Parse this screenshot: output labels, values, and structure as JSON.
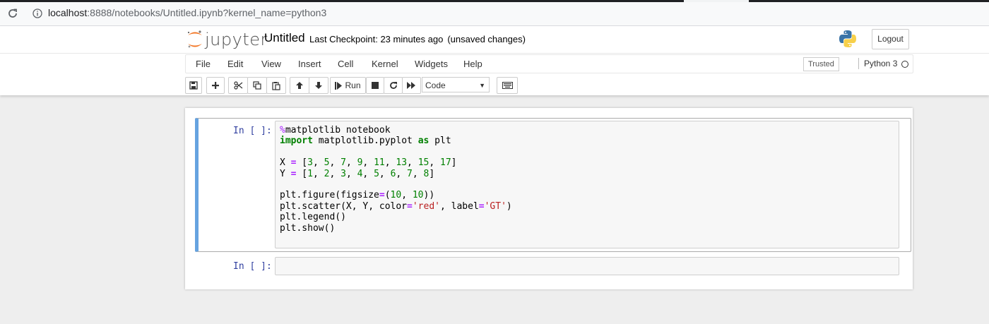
{
  "browser": {
    "url_host": "localhost",
    "url_rest": ":8888/notebooks/Untitled.ipynb?kernel_name=python3"
  },
  "header": {
    "logo_text": "jupyter",
    "notebook_name": "Untitled",
    "checkpoint": "Last Checkpoint: 23 minutes ago",
    "unsaved": "(unsaved changes)",
    "logout_label": "Logout"
  },
  "menu": {
    "items": [
      "File",
      "Edit",
      "View",
      "Insert",
      "Cell",
      "Kernel",
      "Widgets",
      "Help"
    ],
    "trusted": "Trusted",
    "kernel": "Python 3"
  },
  "toolbar": {
    "run_label": "Run",
    "cell_type": "Code"
  },
  "cells": [
    {
      "prompt": "In [ ]:",
      "code": [
        "%matplotlib notebook",
        "import matplotlib.pyplot as plt",
        "",
        "X = [3, 5, 7, 9, 11, 13, 15, 17]",
        "Y = [1, 2, 3, 4, 5, 6, 7, 8]",
        "",
        "plt.figure(figsize=(10, 10))",
        "plt.scatter(X, Y, color='red', label='GT')",
        "plt.legend()",
        "plt.show()"
      ]
    },
    {
      "prompt": "In [ ]:",
      "code": []
    }
  ],
  "colors": {
    "selected_cell_border": "#66a3e0",
    "prompt": "#303f9f",
    "keyword": "#008000",
    "operator": "#aa22ff",
    "string": "#ba2121"
  }
}
